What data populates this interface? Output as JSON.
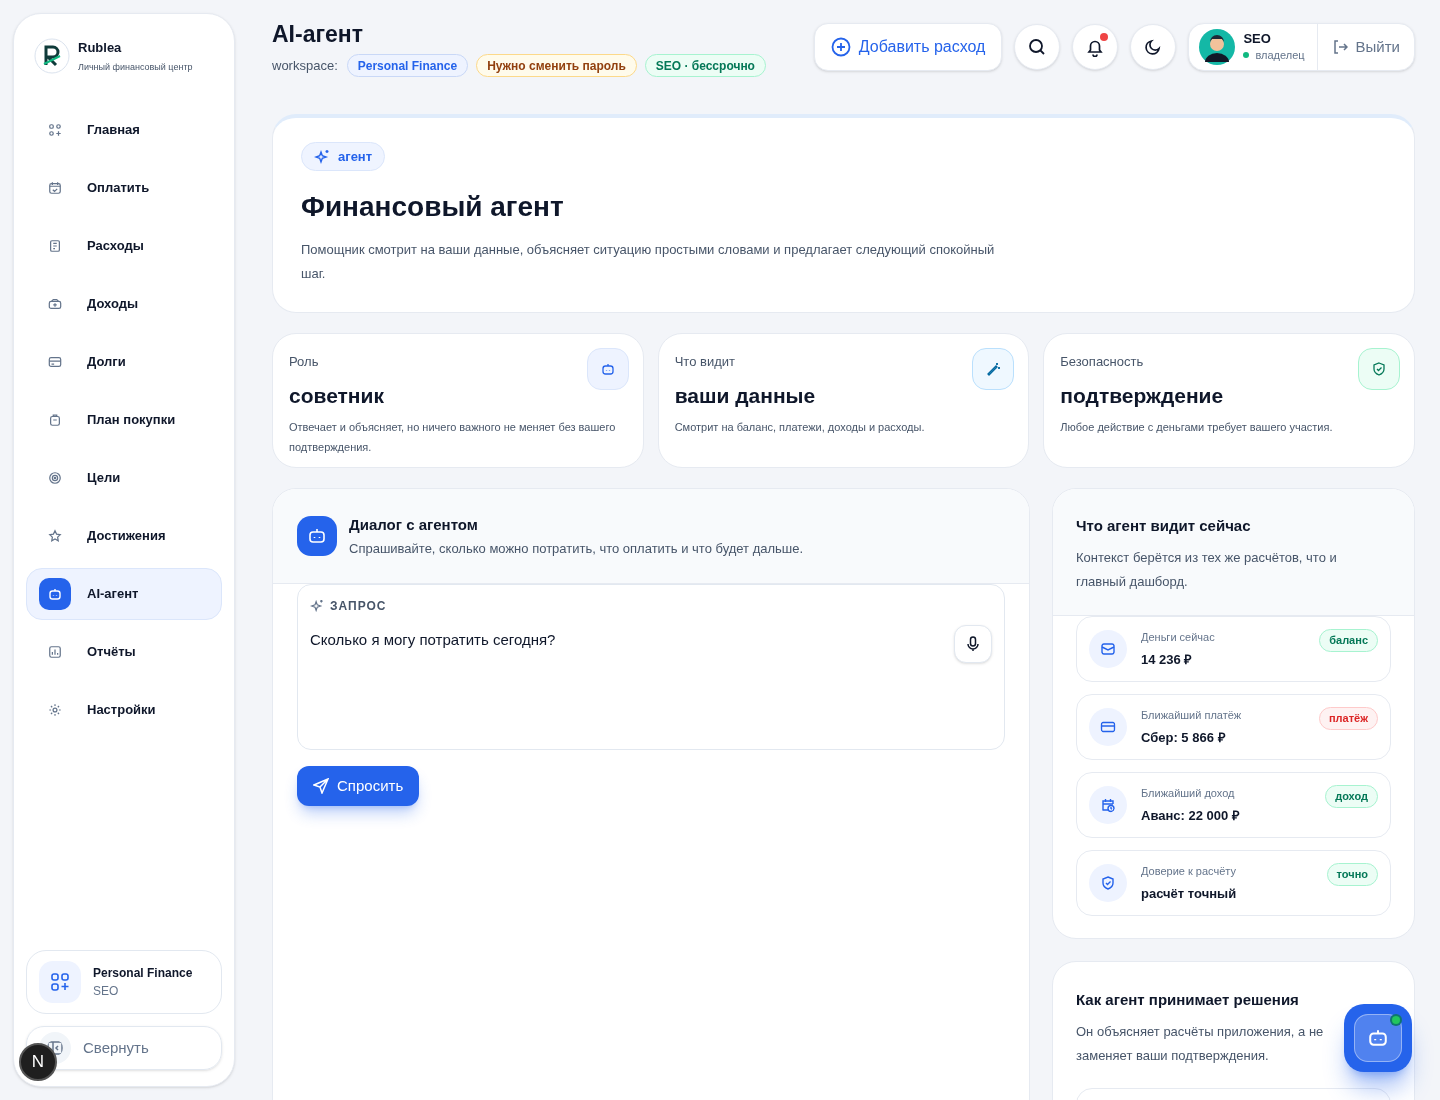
{
  "sidebar": {
    "brand": {
      "name": "Rublea",
      "tagline": "Личный финансовый центр"
    },
    "items": [
      {
        "label": "Главная",
        "selected": false
      },
      {
        "label": "Оплатить",
        "selected": false
      },
      {
        "label": "Расходы",
        "selected": false
      },
      {
        "label": "Доходы",
        "selected": false
      },
      {
        "label": "Долги",
        "selected": false
      },
      {
        "label": "План покупки",
        "selected": false
      },
      {
        "label": "Цели",
        "selected": false
      },
      {
        "label": "Достижения",
        "selected": false
      },
      {
        "label": "AI-агент",
        "selected": true
      },
      {
        "label": "Отчёты",
        "selected": false
      },
      {
        "label": "Настройки",
        "selected": false
      }
    ],
    "workspace": {
      "name": "Personal Finance",
      "role": "SEO"
    },
    "collapse": {
      "label": "Свернуть"
    }
  },
  "overlay_badge": "N",
  "header": {
    "title": "AI-агент",
    "workspace_label": "workspace:",
    "tags": [
      {
        "label": "Personal Finance",
        "kind": "info"
      },
      {
        "label": "Нужно сменить пароль",
        "kind": "warning"
      },
      {
        "label": "SEO · бессрочно",
        "kind": "success"
      }
    ],
    "add_button": "Добавить расход",
    "notifications": {
      "unread": true
    },
    "user": {
      "name": "SEO",
      "role": "владелец",
      "online": true
    },
    "logout": "Выйти"
  },
  "hero": {
    "badge": "агент",
    "title": "Финансовый агент",
    "description": "Помощник смотрит на ваши данные, объясняет ситуацию простыми словами и предлагает следующий спокойный шаг."
  },
  "stats": [
    {
      "label": "Роль",
      "value": "советник",
      "description": "Отвечает и объясняет, но ничего важного не меняет без вашего подтверждения."
    },
    {
      "label": "Что видит",
      "value": "ваши данные",
      "description": "Смотрит на баланс, платежи, доходы и расходы."
    },
    {
      "label": "Безопасность",
      "value": "подтверждение",
      "description": "Любое действие с деньгами требует вашего участия."
    }
  ],
  "chat": {
    "title": "Диалог с агентом",
    "subtitle": "Спрашивайте, сколько можно потратить, что оплатить и что будет дальше.",
    "query_label": "ЗАПРОС",
    "query_value": "Сколько я могу потратить сегодня?",
    "submit": "Спросить"
  },
  "context": {
    "title": "Что агент видит сейчас",
    "subtitle": "Контекст берётся из тех же расчётов, что и главный дашборд.",
    "items": [
      {
        "label": "Деньги сейчас",
        "value": "14 236 ₽",
        "tag": "баланс",
        "kind": "success"
      },
      {
        "label": "Ближайший платёж",
        "value": "Сбер: 5 866 ₽",
        "tag": "платёж",
        "kind": "danger"
      },
      {
        "label": "Ближайший доход",
        "value": "Аванс: 22 000 ₽",
        "tag": "доход",
        "kind": "success"
      },
      {
        "label": "Доверие к расчёту",
        "value": "расчёт точный",
        "tag": "точно",
        "kind": "success"
      }
    ]
  },
  "decisions": {
    "title": "Как агент принимает решения",
    "description": "Он объясняет расчёты приложения, а не заменяет ваши подтверждения."
  }
}
